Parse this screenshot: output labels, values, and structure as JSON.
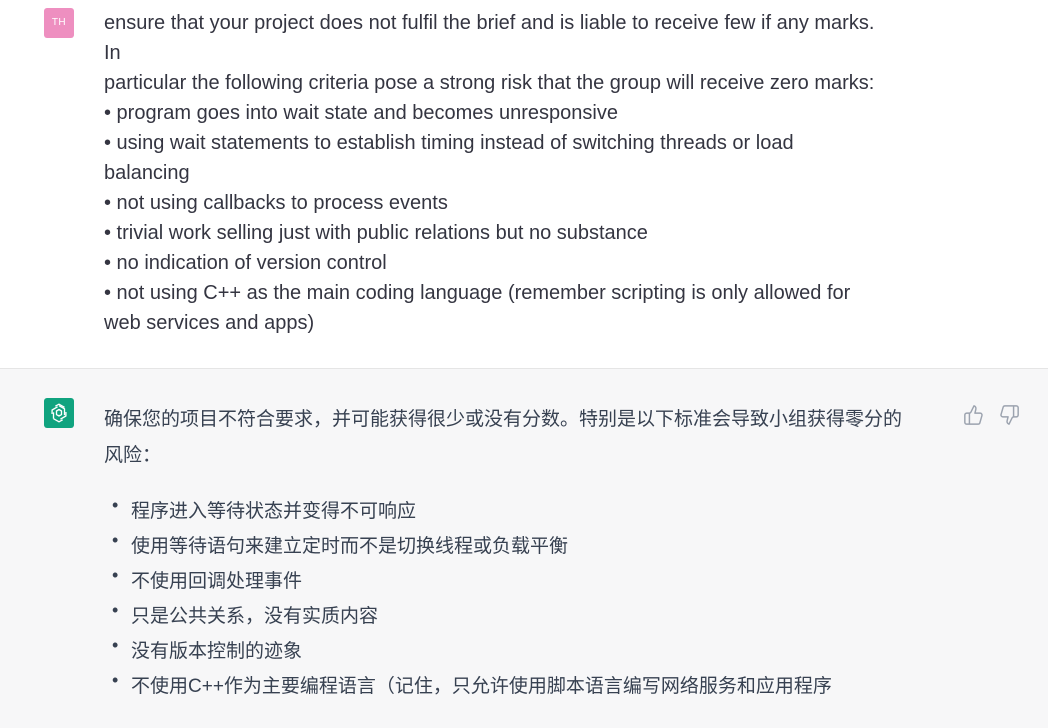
{
  "user": {
    "avatar_initials": "TH",
    "lines": [
      "ensure that your project does not fulfil the brief and is liable to receive few if any marks.",
      "In",
      "particular the following criteria pose a strong risk that the group will receive zero marks:",
      "• program goes into wait state and becomes unresponsive",
      "• using wait statements to establish timing instead of switching threads or load",
      "balancing",
      "• not using callbacks to process events",
      "• trivial work selling just with public relations but no substance",
      "• no indication of version control",
      "• not using C++ as the main coding language (remember scripting is only allowed for",
      "web services and apps)"
    ]
  },
  "assistant": {
    "avatar_icon": "openai-logo-icon",
    "intro_line1": "确保您的项目不符合要求，并可能获得很少或没有分数。特别是以下标准会导致小组获得零分的",
    "intro_line2": "风险：",
    "bullet_glyph": "•",
    "items": [
      "程序进入等待状态并变得不可响应",
      "使用等待语句来建立定时而不是切换线程或负载平衡",
      "不使用回调处理事件",
      "只是公共关系，没有实质内容",
      "没有版本控制的迹象",
      "不使用C++作为主要编程语言（记住，只允许使用脚本语言编写网络服务和应用程序"
    ],
    "feedback": {
      "thumbs_up_icon": "thumbs-up-icon",
      "thumbs_down_icon": "thumbs-down-icon"
    }
  },
  "colors": {
    "user_avatar": "#ee8fc0",
    "assistant_avatar": "#10a37f",
    "assistant_background": "#f7f7f8"
  }
}
